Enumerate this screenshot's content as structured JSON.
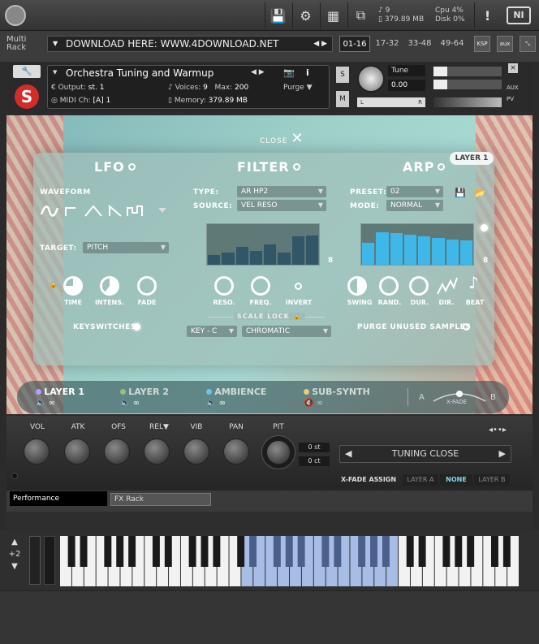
{
  "topbar": {
    "cpu_label": "Cpu",
    "cpu_value": "4%",
    "disk_label": "Disk",
    "disk_value": "0%",
    "voices": "9",
    "memory": "379.89 MB",
    "warn": "!",
    "ni": "NI"
  },
  "rack": {
    "title_line1": "Multi",
    "title_line2": "Rack",
    "download_text": "DOWNLOAD HERE: WWW.4DOWNLOAD.NET",
    "pages": [
      "01-16",
      "17-32",
      "33-48",
      "49-64"
    ],
    "ksp": "KSP",
    "aux": "aux"
  },
  "instrument": {
    "name": "Orchestra Tuning and Warmup",
    "output_label": "Output:",
    "output_value": "st. 1",
    "voices_label": "Voices:",
    "voices_value": "9",
    "max_label": "Max:",
    "max_value": "200",
    "purge": "Purge",
    "midi_label": "MIDI Ch:",
    "midi_value": "[A] 1",
    "memory_label": "Memory:",
    "memory_value": "379.89 MB",
    "s": "S",
    "m": "M",
    "tune_label": "Tune",
    "tune_value": "0.00",
    "l": "L",
    "r": "R",
    "aux": "AUX",
    "pv": "PV"
  },
  "overlay": {
    "close_label": "CLOSE",
    "layer_badge": "LAYER 1"
  },
  "lfo": {
    "title": "LFO",
    "waveform_label": "WAVEFORM",
    "target_label": "TARGET:",
    "target_value": "PITCH",
    "knobs": [
      "TIME",
      "INTENS.",
      "FADE"
    ],
    "keyswitches": "KEYSWITCHES"
  },
  "filter": {
    "title": "FILTER",
    "type_label": "TYPE:",
    "type_value": "AR HP2",
    "source_label": "SOURCE:",
    "source_value": "VEL RESO",
    "steps": "8",
    "knobs": [
      "RESO.",
      "FREQ."
    ],
    "invert": "INVERT",
    "scale_lock": "SCALE LOCK",
    "key_value": "KEY - C",
    "scale_value": "CHROMATIC",
    "bars": [
      0.25,
      0.3,
      0.45,
      0.35,
      0.5,
      0.3,
      0.7,
      0.72
    ]
  },
  "arp": {
    "title": "ARP",
    "preset_label": "PRESET:",
    "preset_value": "02",
    "mode_label": "MODE:",
    "mode_value": "NORMAL",
    "steps": "8",
    "knobs": [
      "SWING",
      "RAND.",
      "DUR.",
      "DIR.",
      "BEAT"
    ],
    "purge": "PURGE UNUSED SAMPLES",
    "bars": [
      0.55,
      0.8,
      0.78,
      0.74,
      0.7,
      0.66,
      0.62,
      0.6
    ]
  },
  "layers": [
    {
      "name": "LAYER 1",
      "color": "#b89cff"
    },
    {
      "name": "LAYER 2",
      "color": "#9bbf7a"
    },
    {
      "name": "AMBIENCE",
      "color": "#6fc3e8"
    },
    {
      "name": "SUB-SYNTH",
      "color": "#e8d06a"
    }
  ],
  "xfade": {
    "a": "A",
    "b": "B",
    "label": "X-FADE"
  },
  "controls": {
    "knobs": [
      "VOL",
      "ATK",
      "OFS",
      "REL",
      "VIB",
      "PAN",
      "PIT"
    ],
    "st": "0 st",
    "ct": "0 ct",
    "preset": "TUNING CLOSE",
    "xfade_assign": "X-FADE ASSIGN",
    "xf_options": [
      "LAYER A",
      "NONE",
      "LAYER B"
    ]
  },
  "tabs": {
    "performance": "Performance",
    "fxrack": "FX Rack"
  },
  "keyboard": {
    "octave": "+2"
  }
}
